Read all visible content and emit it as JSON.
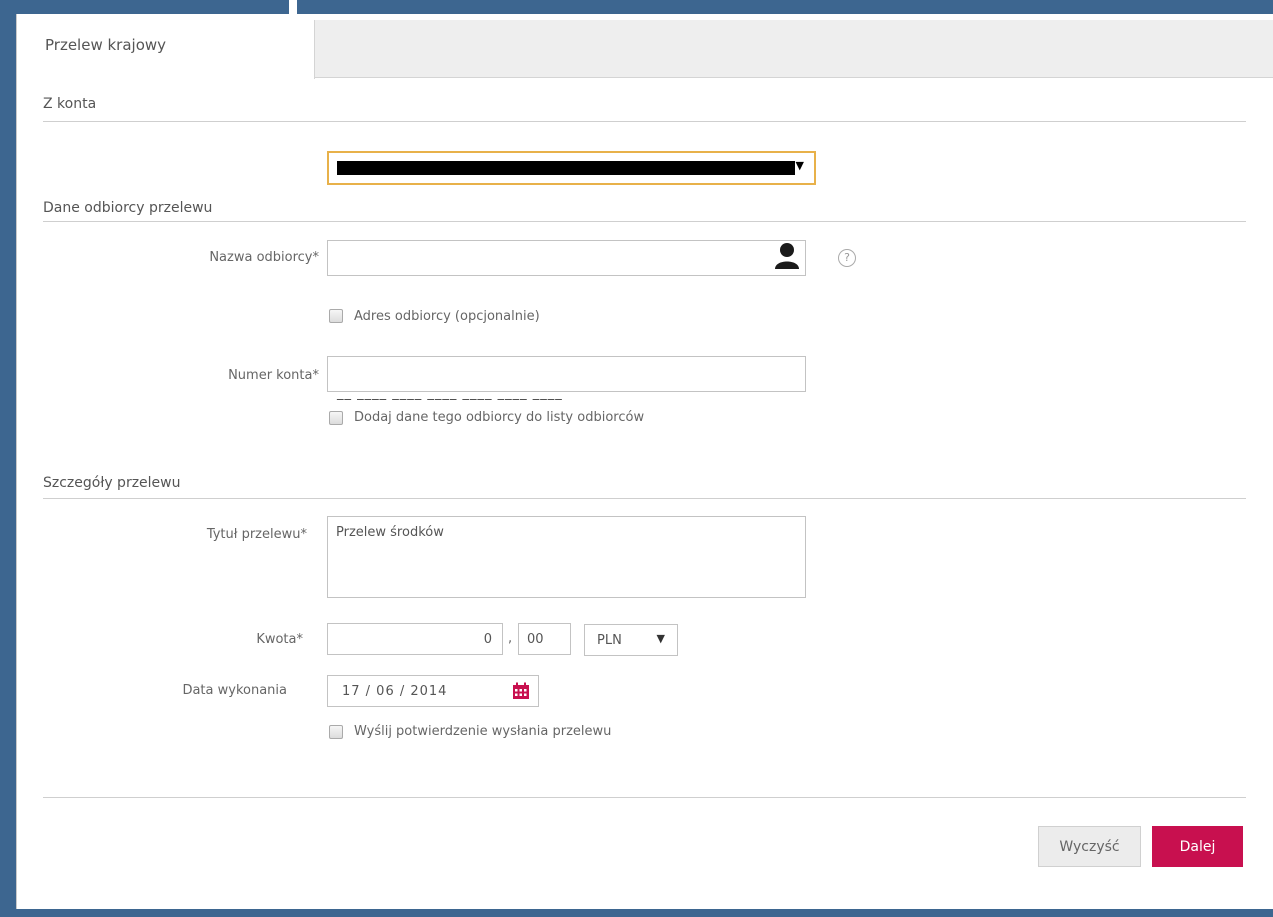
{
  "tab": {
    "label": "Przelew krajowy"
  },
  "from_account": {
    "section_title": "Z konta"
  },
  "recipient": {
    "section_title": "Dane odbiorcy przelewu",
    "name_label": "Nazwa odbiorcy*",
    "name_value": "",
    "help_glyph": "?",
    "address_checkbox_label": "Adres odbiorcy (opcjonalnie)",
    "account_label": "Numer konta*",
    "account_mask": "__ ____ ____ ____ ____ ____ ____",
    "add_to_list_label": "Dodaj dane tego odbiorcy do listy odbiorców"
  },
  "details": {
    "section_title": "Szczegóły przelewu",
    "title_label": "Tytuł przelewu*",
    "title_value": "Przelew środków",
    "amount_label": "Kwota*",
    "amount_int": "0",
    "amount_sep": ",",
    "amount_dec": "00",
    "currency": "PLN",
    "date_label": "Data wykonania",
    "date_value": "17  /  06  /  2014",
    "confirm_label": "Wyślij potwierdzenie wysłania przelewu"
  },
  "buttons": {
    "clear": "Wyczyść",
    "next": "Dalej"
  },
  "icons": {
    "dropdown": "caret-down-icon",
    "recipient": "person-icon",
    "help": "help-circle-icon",
    "calendar": "calendar-icon"
  },
  "colors": {
    "accent": "#c8104f",
    "focus_border": "#e8b14a",
    "background": "#3d6690"
  }
}
